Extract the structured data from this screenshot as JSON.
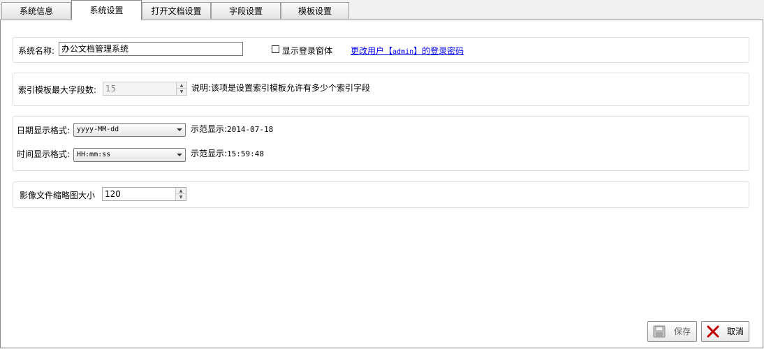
{
  "tabs": [
    {
      "label": "系统信息"
    },
    {
      "label": "系统设置"
    },
    {
      "label": "打开文档设置"
    },
    {
      "label": "字段设置"
    },
    {
      "label": "模板设置"
    }
  ],
  "active_tab": "系统设置",
  "system_name": {
    "label": "系统名称:",
    "value": "办公文档管理系统"
  },
  "show_login": {
    "label": "显示登录窗体",
    "checked": false
  },
  "change_password": {
    "prefix": "更改用户【",
    "user": "admin",
    "suffix": "】的登录密码"
  },
  "index_template": {
    "label": "索引模板最大字段数:",
    "value": "15",
    "note": "说明:该项是设置索引模板允许有多少个索引字段"
  },
  "date_format": {
    "label": "日期显示格式:",
    "value": "yyyy-MM-dd",
    "example_label": "示范显示:",
    "example_value": "2014-07-18"
  },
  "time_format": {
    "label": "时间显示格式:",
    "value": "HH:mm:ss",
    "example_label": "示范显示:",
    "example_value": "15:59:48"
  },
  "thumbnail": {
    "label": "影像文件缩略图大小",
    "value": "120"
  },
  "buttons": {
    "save": "保存",
    "cancel": "取消"
  },
  "colors": {
    "link": "#0000ee",
    "cancel_icon": "#c00000"
  }
}
